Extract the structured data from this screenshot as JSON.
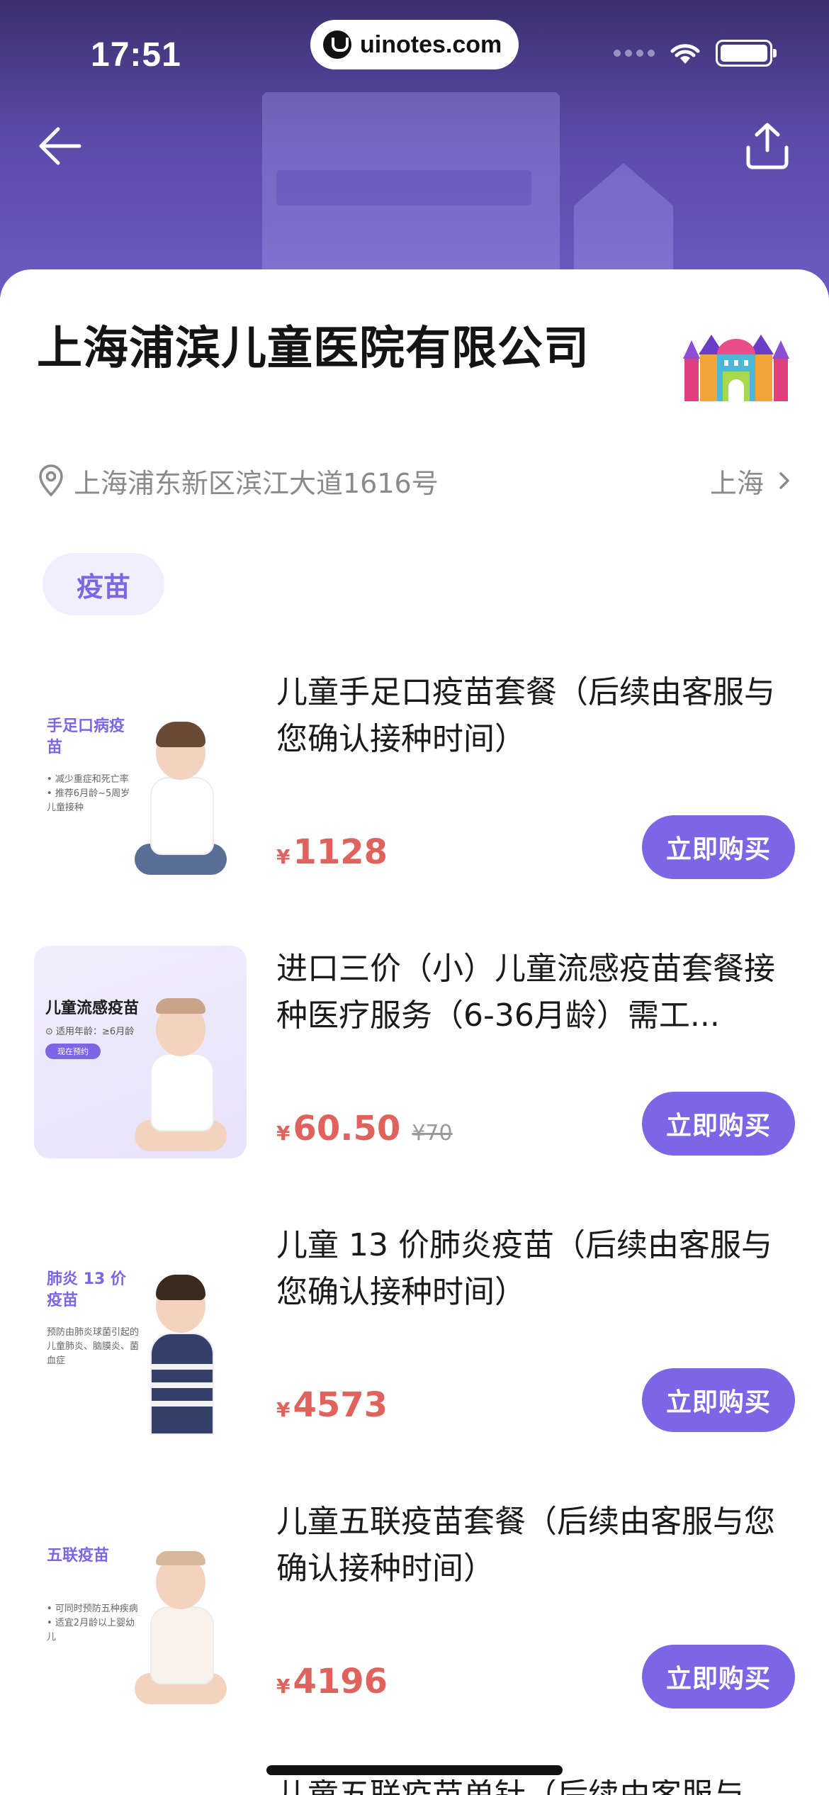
{
  "status_bar": {
    "time": "17:51",
    "url": "uinotes.com"
  },
  "nav": {
    "back_icon": "arrow-left-icon",
    "share_icon": "share-icon"
  },
  "hospital": {
    "name": "上海浦滨儿童医院有限公司",
    "address": "上海浦东新区滨江大道1616号",
    "city": "上海"
  },
  "category_tag": "疫苗",
  "products": [
    {
      "title": "儿童手足口疫苗套餐（后续由客服与您确认接种时间）",
      "price_symbol": "¥",
      "price": "1128",
      "old_price": "",
      "buy_label": "立即购买",
      "thumb_title": "手足口病疫苗",
      "thumb_note": "• 减少重症和死亡率\n• 推荐6月龄~5周岁儿童接种"
    },
    {
      "title": "进口三价（小）儿童流感疫苗套餐接种医疗服务（6-36月龄）需工...",
      "price_symbol": "¥",
      "price": "60.50",
      "old_price": "¥70",
      "buy_label": "立即购买",
      "thumb_title": "儿童流感疫苗",
      "thumb_sub": "⊙ 适用年龄：≥6月龄",
      "thumb_chip": "现在预约"
    },
    {
      "title": "儿童 13 价肺炎疫苗（后续由客服与您确认接种时间）",
      "price_symbol": "¥",
      "price": "4573",
      "old_price": "",
      "buy_label": "立即购买",
      "thumb_title": "肺炎 13 价疫苗",
      "thumb_note": "预防由肺炎球菌引起的儿童肺炎、脑膜炎、菌血症"
    },
    {
      "title": "儿童五联疫苗套餐（后续由客服与您确认接种时间）",
      "price_symbol": "¥",
      "price": "4196",
      "old_price": "",
      "buy_label": "立即购买",
      "thumb_title": "五联疫苗",
      "thumb_note": "• 可同时预防五种疾病\n• 适宜2月龄以上婴幼儿"
    }
  ],
  "next_item_peek": "儿童五联疫苗单针（后续由客服与",
  "colors": {
    "accent": "#7d66e6",
    "price": "#e0625d",
    "header_dark": "#3b2f6e"
  }
}
